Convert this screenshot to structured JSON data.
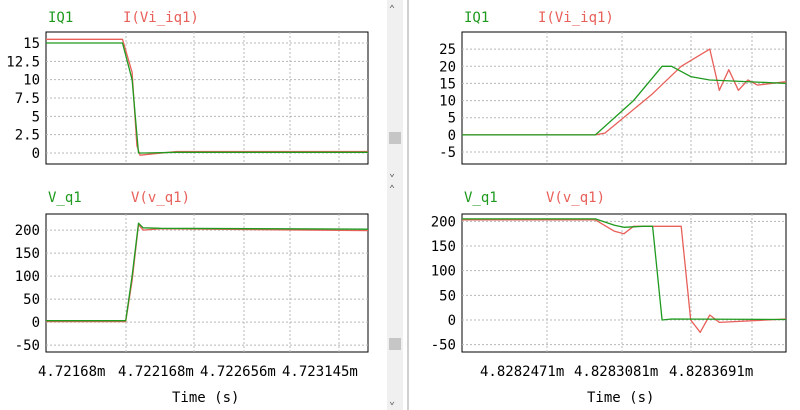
{
  "colors": {
    "green": "#1f9a1f",
    "red": "#e8605a",
    "grid": "#b8b8b8",
    "axis": "#000000",
    "scroll_thumb": "#c6c6c6",
    "scroll_track": "#f0f0f0"
  },
  "panes": [
    {
      "time_label": "Time (s)",
      "x_ticks": [
        "4.72168m",
        "4.722168m",
        "4.722656m",
        "4.723145m"
      ]
    },
    {
      "time_label": "Time (s)",
      "x_ticks": [
        "4.8282471m",
        "4.8283081m",
        "4.8283691m"
      ]
    }
  ],
  "scroll_icons": {
    "up": "chevron-up-icon",
    "down": "chevron-down-icon"
  },
  "chart_data": [
    {
      "type": "line",
      "x_unit": "ms",
      "series": [
        {
          "name": "IQ1",
          "color": "#1f9a1f",
          "x": [
            4.72158,
            4.72206,
            4.72212,
            4.72216,
            4.7222,
            4.7224,
            4.7236
          ],
          "y": [
            15,
            15,
            10,
            0,
            0,
            0.1,
            0.1
          ]
        },
        {
          "name": "I(Vi_iq1)",
          "color": "#e8605a",
          "x": [
            4.72158,
            4.72206,
            4.72212,
            4.72215,
            4.72217,
            4.7224,
            4.7236
          ],
          "y": [
            15.5,
            15.5,
            11,
            1,
            -0.3,
            0.2,
            0.2
          ]
        }
      ],
      "yticks": [
        15,
        12.5,
        10,
        7.5,
        5,
        2.5,
        0
      ],
      "ylim": [
        -1.5,
        16.5
      ],
      "grid": true,
      "legend": "top-left"
    },
    {
      "type": "line",
      "x_unit": "ms",
      "series": [
        {
          "name": "V_q1",
          "color": "#1f9a1f",
          "x": [
            4.72158,
            4.72208,
            4.72212,
            4.72216,
            4.72219,
            4.7223,
            4.7236
          ],
          "y": [
            3,
            3,
            100,
            215,
            205,
            204,
            202
          ]
        },
        {
          "name": "V(v_q1)",
          "color": "#e8605a",
          "x": [
            4.72158,
            4.72208,
            4.72212,
            4.72216,
            4.72219,
            4.7223,
            4.7236
          ],
          "y": [
            1,
            1,
            90,
            212,
            200,
            203,
            199
          ]
        }
      ],
      "yticks": [
        200,
        150,
        100,
        50,
        0,
        -50
      ],
      "ylim": [
        -65,
        235
      ],
      "grid": true,
      "legend": "top-left"
    },
    {
      "type": "line",
      "x_unit": "ms",
      "series": [
        {
          "name": "IQ1",
          "color": "#1f9a1f",
          "x": [
            4.82816,
            4.8283,
            4.82834,
            4.82837,
            4.82838,
            4.8284,
            4.82842,
            4.8285
          ],
          "y": [
            0,
            0,
            10,
            20,
            20,
            17,
            16,
            15
          ]
        },
        {
          "name": "I(Vi_iq1)",
          "color": "#e8605a",
          "x": [
            4.82816,
            4.8283,
            4.82831,
            4.82836,
            4.82839,
            4.82842,
            4.82843,
            4.82844,
            4.82845,
            4.82846,
            4.82847,
            4.8285
          ],
          "y": [
            0,
            0,
            0.5,
            12,
            20,
            25,
            13,
            19,
            13,
            16,
            14.5,
            15.5
          ]
        }
      ],
      "yticks": [
        25,
        20,
        15,
        10,
        5,
        0,
        -5
      ],
      "ylim": [
        -8.5,
        30
      ],
      "grid": true,
      "legend": "top-left"
    },
    {
      "type": "line",
      "x_unit": "ms",
      "series": [
        {
          "name": "V_q1",
          "color": "#1f9a1f",
          "x": [
            4.82816,
            4.8283,
            4.82832,
            4.82833,
            4.82835,
            4.82836,
            4.82837,
            4.82838,
            4.8285
          ],
          "y": [
            205,
            205,
            192,
            188,
            190,
            190,
            0,
            2,
            1
          ]
        },
        {
          "name": "V(v_q1)",
          "color": "#e8605a",
          "x": [
            4.82816,
            4.8283,
            4.82832,
            4.82833,
            4.82834,
            4.82835,
            4.82837,
            4.82839,
            4.8284,
            4.82841,
            4.82842,
            4.82843,
            4.8285
          ],
          "y": [
            203,
            203,
            180,
            175,
            190,
            190,
            190,
            190,
            0,
            -25,
            10,
            -5,
            2
          ]
        }
      ],
      "yticks": [
        200,
        150,
        100,
        50,
        0,
        -50
      ],
      "ylim": [
        -65,
        215
      ],
      "grid": true,
      "legend": "top-left"
    }
  ]
}
